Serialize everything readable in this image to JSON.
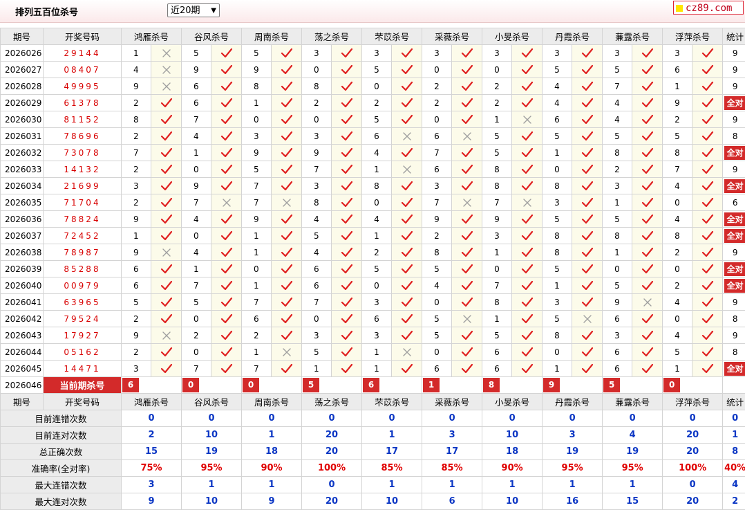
{
  "header": {
    "title": "排列五百位杀号",
    "period_select": "近20期",
    "logo": "cz89.com"
  },
  "columns": {
    "period": "期号",
    "draw": "开奖号码",
    "experts": [
      "鸿雁杀号",
      "谷风杀号",
      "周南杀号",
      "荡之杀号",
      "芣苡杀号",
      "采薇杀号",
      "小旻杀号",
      "丹霞杀号",
      "蒹露杀号",
      "浮萍杀号"
    ],
    "stat": "统计"
  },
  "all_correct_label": "全对",
  "rows": [
    {
      "period": "2026026",
      "draw": "29144",
      "kills": [
        "1",
        "5",
        "5",
        "3",
        "3",
        "3",
        "3",
        "3",
        "3",
        "3"
      ],
      "ok": [
        0,
        1,
        1,
        1,
        1,
        1,
        1,
        1,
        1,
        1
      ],
      "stat": "9"
    },
    {
      "period": "2026027",
      "draw": "08407",
      "kills": [
        "4",
        "9",
        "9",
        "0",
        "5",
        "0",
        "0",
        "5",
        "5",
        "6"
      ],
      "ok": [
        0,
        1,
        1,
        1,
        1,
        1,
        1,
        1,
        1,
        1
      ],
      "stat": "9"
    },
    {
      "period": "2026028",
      "draw": "49995",
      "kills": [
        "9",
        "6",
        "8",
        "8",
        "0",
        "2",
        "2",
        "4",
        "7",
        "1"
      ],
      "ok": [
        0,
        1,
        1,
        1,
        1,
        1,
        1,
        1,
        1,
        1
      ],
      "stat": "9"
    },
    {
      "period": "2026029",
      "draw": "61378",
      "kills": [
        "2",
        "6",
        "1",
        "2",
        "2",
        "2",
        "2",
        "4",
        "4",
        "9"
      ],
      "ok": [
        1,
        1,
        1,
        1,
        1,
        1,
        1,
        1,
        1,
        1
      ],
      "stat": "全对"
    },
    {
      "period": "2026030",
      "draw": "81152",
      "kills": [
        "8",
        "7",
        "0",
        "0",
        "5",
        "0",
        "1",
        "6",
        "4",
        "2"
      ],
      "ok": [
        1,
        1,
        1,
        1,
        1,
        1,
        0,
        1,
        1,
        1
      ],
      "stat": "9"
    },
    {
      "period": "2026031",
      "draw": "78696",
      "kills": [
        "2",
        "4",
        "3",
        "3",
        "6",
        "6",
        "5",
        "5",
        "5",
        "5"
      ],
      "ok": [
        1,
        1,
        1,
        1,
        0,
        0,
        1,
        1,
        1,
        1
      ],
      "stat": "8"
    },
    {
      "period": "2026032",
      "draw": "73078",
      "kills": [
        "7",
        "1",
        "9",
        "9",
        "4",
        "7",
        "5",
        "1",
        "8",
        "8"
      ],
      "ok": [
        1,
        1,
        1,
        1,
        1,
        1,
        1,
        1,
        1,
        1
      ],
      "stat": "全对"
    },
    {
      "period": "2026033",
      "draw": "14132",
      "kills": [
        "2",
        "0",
        "5",
        "7",
        "1",
        "6",
        "8",
        "0",
        "2",
        "7"
      ],
      "ok": [
        1,
        1,
        1,
        1,
        0,
        1,
        1,
        1,
        1,
        1
      ],
      "stat": "9"
    },
    {
      "period": "2026034",
      "draw": "21699",
      "kills": [
        "3",
        "9",
        "7",
        "3",
        "8",
        "3",
        "8",
        "8",
        "3",
        "4"
      ],
      "ok": [
        1,
        1,
        1,
        1,
        1,
        1,
        1,
        1,
        1,
        1
      ],
      "stat": "全对"
    },
    {
      "period": "2026035",
      "draw": "71704",
      "kills": [
        "2",
        "7",
        "7",
        "8",
        "0",
        "7",
        "7",
        "3",
        "1",
        "0"
      ],
      "ok": [
        1,
        0,
        0,
        1,
        1,
        0,
        0,
        1,
        1,
        1
      ],
      "stat": "6"
    },
    {
      "period": "2026036",
      "draw": "78824",
      "kills": [
        "9",
        "4",
        "9",
        "4",
        "4",
        "9",
        "9",
        "5",
        "5",
        "4"
      ],
      "ok": [
        1,
        1,
        1,
        1,
        1,
        1,
        1,
        1,
        1,
        1
      ],
      "stat": "全对"
    },
    {
      "period": "2026037",
      "draw": "72452",
      "kills": [
        "1",
        "0",
        "1",
        "5",
        "1",
        "2",
        "3",
        "8",
        "8",
        "8"
      ],
      "ok": [
        1,
        1,
        1,
        1,
        1,
        1,
        1,
        1,
        1,
        1
      ],
      "stat": "全对"
    },
    {
      "period": "2026038",
      "draw": "78987",
      "kills": [
        "9",
        "4",
        "1",
        "4",
        "2",
        "8",
        "1",
        "8",
        "1",
        "2"
      ],
      "ok": [
        0,
        1,
        1,
        1,
        1,
        1,
        1,
        1,
        1,
        1
      ],
      "stat": "9"
    },
    {
      "period": "2026039",
      "draw": "85288",
      "kills": [
        "6",
        "1",
        "0",
        "6",
        "5",
        "5",
        "0",
        "5",
        "0",
        "0"
      ],
      "ok": [
        1,
        1,
        1,
        1,
        1,
        1,
        1,
        1,
        1,
        1
      ],
      "stat": "全对"
    },
    {
      "period": "2026040",
      "draw": "00979",
      "kills": [
        "6",
        "7",
        "1",
        "6",
        "0",
        "4",
        "7",
        "1",
        "5",
        "2"
      ],
      "ok": [
        1,
        1,
        1,
        1,
        1,
        1,
        1,
        1,
        1,
        1
      ],
      "stat": "全对"
    },
    {
      "period": "2026041",
      "draw": "63965",
      "kills": [
        "5",
        "5",
        "7",
        "7",
        "3",
        "0",
        "8",
        "3",
        "9",
        "4"
      ],
      "ok": [
        1,
        1,
        1,
        1,
        1,
        1,
        1,
        1,
        0,
        1
      ],
      "stat": "9"
    },
    {
      "period": "2026042",
      "draw": "79524",
      "kills": [
        "2",
        "0",
        "6",
        "0",
        "6",
        "5",
        "1",
        "5",
        "6",
        "0"
      ],
      "ok": [
        1,
        1,
        1,
        1,
        1,
        0,
        1,
        0,
        1,
        1
      ],
      "stat": "8"
    },
    {
      "period": "2026043",
      "draw": "17927",
      "kills": [
        "9",
        "2",
        "2",
        "3",
        "3",
        "5",
        "5",
        "8",
        "3",
        "4"
      ],
      "ok": [
        0,
        1,
        1,
        1,
        1,
        1,
        1,
        1,
        1,
        1
      ],
      "stat": "9"
    },
    {
      "period": "2026044",
      "draw": "05162",
      "kills": [
        "2",
        "0",
        "1",
        "5",
        "1",
        "0",
        "6",
        "0",
        "6",
        "5"
      ],
      "ok": [
        1,
        1,
        0,
        1,
        0,
        1,
        1,
        1,
        1,
        1
      ],
      "stat": "8"
    },
    {
      "period": "2026045",
      "draw": "14471",
      "kills": [
        "3",
        "7",
        "7",
        "1",
        "1",
        "6",
        "6",
        "1",
        "6",
        "1"
      ],
      "ok": [
        1,
        1,
        1,
        1,
        1,
        1,
        1,
        1,
        1,
        1
      ],
      "stat": "全对"
    }
  ],
  "current": {
    "period": "2026046",
    "label": "当前期杀号",
    "kills": [
      "6",
      "0",
      "0",
      "5",
      "6",
      "1",
      "8",
      "9",
      "5",
      "0"
    ]
  },
  "stats": [
    {
      "label": "目前连错次数",
      "values": [
        "0",
        "0",
        "0",
        "0",
        "0",
        "0",
        "0",
        "0",
        "0",
        "0",
        "0"
      ],
      "color": "blue"
    },
    {
      "label": "目前连对次数",
      "values": [
        "2",
        "10",
        "1",
        "20",
        "1",
        "3",
        "10",
        "3",
        "4",
        "20",
        "1"
      ],
      "color": "blue"
    },
    {
      "label": "总正确次数",
      "values": [
        "15",
        "19",
        "18",
        "20",
        "17",
        "17",
        "18",
        "19",
        "19",
        "20",
        "8"
      ],
      "color": "blue"
    },
    {
      "label": "准确率(全对率)",
      "values": [
        "75%",
        "95%",
        "90%",
        "100%",
        "85%",
        "85%",
        "90%",
        "95%",
        "95%",
        "100%",
        "40%"
      ],
      "color": "red"
    },
    {
      "label": "最大连错次数",
      "values": [
        "3",
        "1",
        "1",
        "0",
        "1",
        "1",
        "1",
        "1",
        "1",
        "0",
        "4"
      ],
      "color": "blue"
    },
    {
      "label": "最大连对次数",
      "values": [
        "9",
        "10",
        "9",
        "20",
        "10",
        "6",
        "10",
        "16",
        "15",
        "20",
        "2"
      ],
      "color": "blue"
    }
  ],
  "colors": {
    "accent_red": "#d32a2a",
    "check_red": "#e02020",
    "cross_gray": "#a0a0a0",
    "stat_blue": "#0b36c4"
  }
}
